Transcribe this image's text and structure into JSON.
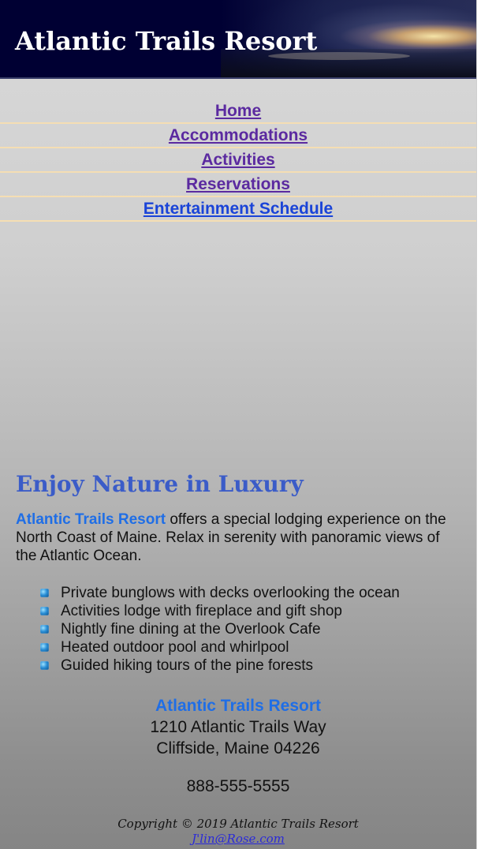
{
  "header": {
    "title": "Atlantic Trails Resort"
  },
  "nav": {
    "items": [
      {
        "label": "Home"
      },
      {
        "label": "Accommodations"
      },
      {
        "label": "Activities"
      },
      {
        "label": "Reservations"
      },
      {
        "label": "Entertainment Schedule"
      }
    ]
  },
  "main": {
    "heading": "Enjoy Nature in Luxury",
    "intro_brand": "Atlantic Trails Resort",
    "intro_text": " offers a special lodging experience on the North Coast of Maine. Relax in serenity with panoramic views of the Atlantic Ocean.",
    "features": [
      "Private bunglows with decks overlooking the ocean",
      "Activities lodge with fireplace and gift shop",
      "Nightly fine dining at the Overlook Cafe",
      "Heated outdoor pool and whirlpool",
      "Guided hiking tours of the pine forests"
    ]
  },
  "contact": {
    "name": "Atlantic Trails Resort",
    "street": "1210 Atlantic Trails Way",
    "city": "Cliffside, Maine 04226",
    "phone": "888-555-5555"
  },
  "footer": {
    "copyright": "Copyright © 2019 Atlantic Trails Resort",
    "email": "J'lin@Rose.com"
  },
  "colors": {
    "header_bg": "#000033",
    "nav_link": "#5b2aa0",
    "nav_link_current": "#1a44d8",
    "heading": "#3b5cc8",
    "brand": "#1f6ee6",
    "nav_divider": "#f5deb3"
  },
  "icons": {
    "feature_bullet": "blue-square-bullet-icon"
  }
}
